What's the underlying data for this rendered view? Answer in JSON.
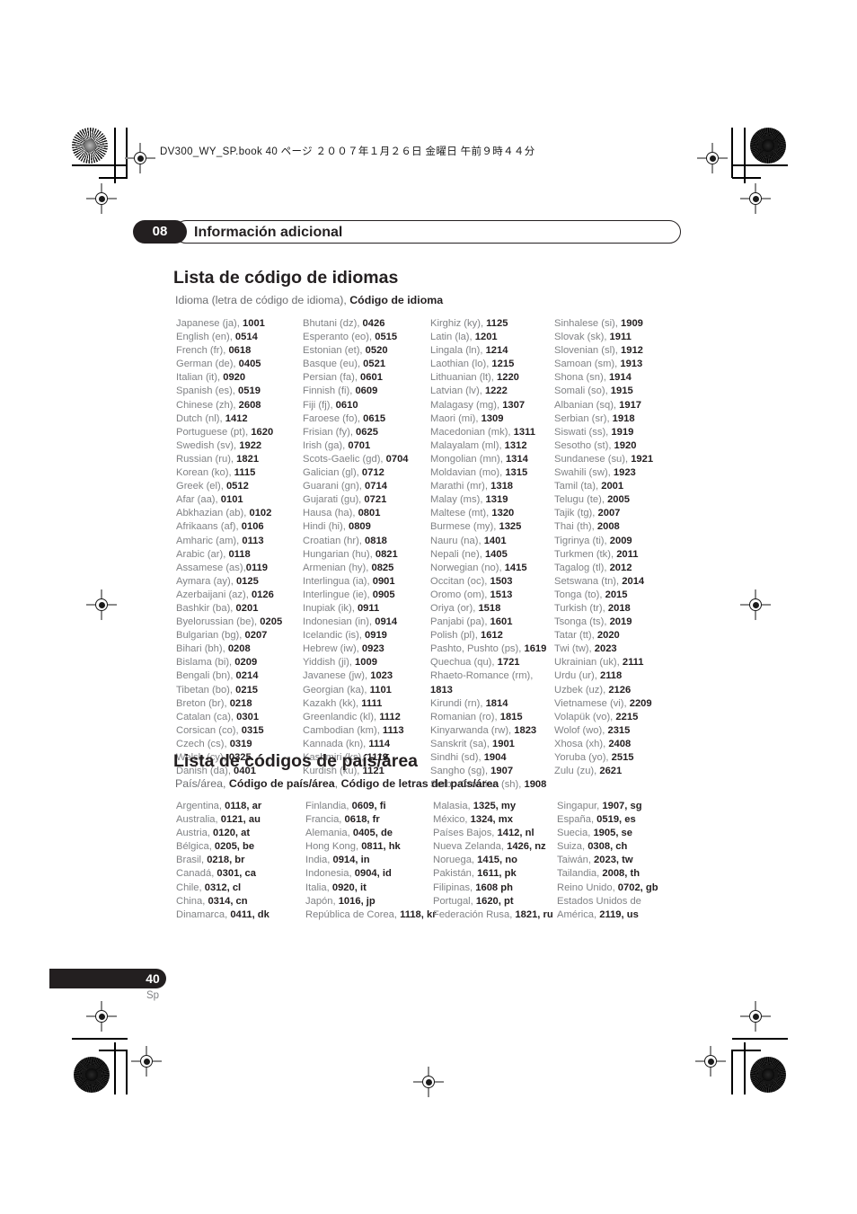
{
  "page_header": {
    "file_line": "DV300_WY_SP.book   40 ページ   ２００７年１月２６日   金曜日   午前９時４４分"
  },
  "chapter": {
    "number": "08",
    "title": "Información adicional"
  },
  "language_section": {
    "heading": "Lista de código de idiomas",
    "subhead_plain": "Idioma (letra de código de idioma), ",
    "subhead_bold": "Código de idioma",
    "columns": [
      [
        "Japanese (ja), |1001",
        "English (en), |0514",
        "French (fr), |0618",
        "German (de), |0405",
        "Italian (it), |0920",
        "Spanish (es), |0519",
        "Chinese (zh), |2608",
        "Dutch (nl), |1412",
        "Portuguese (pt), |1620",
        "Swedish (sv), |1922",
        "Russian (ru), |1821",
        "Korean (ko), |1115",
        "Greek (el), |0512",
        "Afar (aa), |0101",
        "Abkhazian (ab), |0102",
        "Afrikaans (af), |0106",
        "Amharic (am), |0113",
        "Arabic (ar), |0118",
        "Assamese (as),|0119",
        "Aymara (ay), |0125",
        "Azerbaijani (az), |0126",
        "Bashkir (ba), |0201",
        "Byelorussian (be), |0205",
        "Bulgarian (bg), |0207",
        "Bihari (bh), |0208",
        "Bislama (bi), |0209",
        "Bengali (bn), |0214",
        "Tibetan (bo), |0215",
        "Breton (br), |0218",
        "Catalan (ca), |0301",
        "Corsican (co), |0315",
        "Czech (cs), |0319",
        "Welsh (cy), |0325",
        "Danish (da), |0401"
      ],
      [
        "Bhutani (dz), |0426",
        "Esperanto (eo), |0515",
        "Estonian (et), |0520",
        "Basque (eu), |0521",
        "Persian (fa), |0601",
        "Finnish (fi), |0609",
        "Fiji (fj), |0610",
        "Faroese (fo), |0615",
        "Frisian (fy), |0625",
        "Irish (ga), |0701",
        "Scots-Gaelic (gd), |0704",
        "Galician (gl), |0712",
        "Guarani (gn), |0714",
        "Gujarati (gu), |0721",
        "Hausa (ha), |0801",
        "Hindi (hi), |0809",
        "Croatian (hr), |0818",
        "Hungarian (hu), |0821",
        "Armenian (hy), |0825",
        "Interlingua (ia), |0901",
        "Interlingue (ie), |0905",
        "Inupiak (ik), |0911",
        "Indonesian (in), |0914",
        "Icelandic (is), |0919",
        "Hebrew (iw), |0923",
        "Yiddish (ji), |1009",
        "Javanese (jw), |1023",
        "Georgian (ka), |1101",
        "Kazakh (kk), |1111",
        "Greenlandic (kl), |1112",
        "Cambodian (km), |1113",
        "Kannada (kn), |1114",
        "Kashmiri (ks), |1119",
        "Kurdish (ku), |1121"
      ],
      [
        "Kirghiz (ky), |1125",
        "Latin (la), |1201",
        "Lingala (ln), |1214",
        "Laothian (lo), |1215",
        "Lithuanian (lt), |1220",
        "Latvian (lv), |1222",
        "Malagasy (mg), |1307",
        "Maori (mi), |1309",
        "Macedonian (mk), |1311",
        "Malayalam (ml), |1312",
        "Mongolian (mn), |1314",
        "Moldavian (mo), |1315",
        "Marathi (mr), |1318",
        "Malay (ms), |1319",
        "Maltese (mt), |1320",
        "Burmese (my), |1325",
        "Nauru (na), |1401",
        "Nepali (ne), |1405",
        "Norwegian (no), |1415",
        "Occitan (oc), |1503",
        "Oromo (om), |1513",
        "Oriya (or), |1518",
        "Panjabi (pa), |1601",
        "Polish (pl), |1612",
        "Pashto, Pushto (ps), |1619",
        "Quechua (qu), |1721",
        "Rhaeto-Romance (rm), ",
        "|1813",
        "Kirundi (rn), |1814",
        "Romanian (ro), |1815",
        "Kinyarwanda (rw), |1823",
        "Sanskrit (sa), |1901",
        "Sindhi (sd), |1904",
        "Sangho (sg), |1907",
        "Serbo-Croatian (sh), |1908"
      ],
      [
        "Sinhalese (si), |1909",
        "Slovak (sk), |1911",
        "Slovenian (sl), |1912",
        "Samoan (sm), |1913",
        "Shona (sn), |1914",
        "Somali (so), |1915",
        "Albanian (sq), |1917",
        "Serbian (sr), |1918",
        "Siswati (ss), |1919",
        "Sesotho (st), |1920",
        "Sundanese (su), |1921",
        "Swahili (sw), |1923",
        "Tamil (ta), |2001",
        "Telugu (te), |2005",
        "Tajik (tg), |2007",
        "Thai (th), |2008",
        "Tigrinya (ti), |2009",
        "Turkmen (tk), |2011",
        "Tagalog (tl), |2012",
        "Setswana (tn), |2014",
        "Tonga (to), |2015",
        "Turkish (tr), |2018",
        "Tsonga (ts), |2019",
        "Tatar (tt), |2020",
        "Twi (tw), |2023",
        "Ukrainian (uk), |2111",
        "Urdu (ur), |2118",
        "Uzbek (uz), |2126",
        "Vietnamese (vi), |2209",
        "Volapük (vo), |2215",
        "Wolof (wo), |2315",
        "Xhosa (xh), |2408",
        "Yoruba (yo), |2515",
        "Zulu (zu), |2621"
      ]
    ]
  },
  "country_section": {
    "heading": "Lista de códigos de país/área",
    "subhead_plain": "País/área, ",
    "subhead_bold1": "Código de país/área",
    "subhead_sep": ", ",
    "subhead_bold2": "Código de letras del país/área",
    "columns": [
      [
        "Argentina, |0118, ar",
        "Australia, |0121, au",
        "Austria, |0120, at",
        "Bélgica, |0205, be",
        "Brasil, |0218, br",
        "Canadá, |0301, ca",
        "Chile, |0312, cl",
        "China, |0314, cn",
        "Dinamarca, |0411, dk"
      ],
      [
        "Finlandia, |0609, fi",
        "Francia, |0618, fr",
        "Alemania, |0405, de",
        "Hong Kong, |0811, hk",
        "India, |0914, in",
        "Indonesia, |0904, id",
        "Italia, |0920, it",
        "Japón, |1016, jp",
        "República de Corea, |1118, kr"
      ],
      [
        "Malasia, |1325, my",
        "México, |1324, mx",
        "Países Bajos, |1412, nl",
        "Nueva Zelanda, |1426, nz",
        "Noruega, |1415, no",
        "Pakistán, |1611, pk",
        "Filipinas, |1608 ph",
        "Portugal, |1620, pt",
        "Federación Rusa, |1821, ru"
      ],
      [
        "Singapur, |1907, sg",
        "España, |0519, es",
        "Suecia, |1905, se",
        "Suiza, |0308, ch",
        "Taiwán, |2023, tw",
        "Tailandia, |2008, th",
        "Reino Unido, |0702, gb",
        "Estados Unidos de ",
        "América, |2119, us"
      ]
    ]
  },
  "footer": {
    "page_number": "40",
    "page_language": "Sp"
  },
  "colors": {
    "ink_black": "#231f20",
    "body_gray": "#808285",
    "subhead_gray": "#6d6e71"
  }
}
